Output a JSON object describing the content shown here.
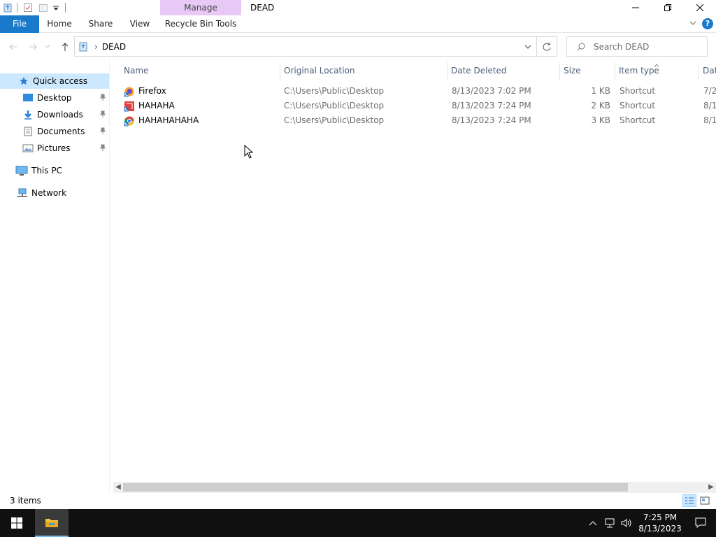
{
  "window": {
    "title": "DEAD",
    "context_tab": "Manage",
    "context_sub": "Recycle Bin Tools"
  },
  "ribbon": {
    "tabs": [
      "File",
      "Home",
      "Share",
      "View",
      "Recycle Bin Tools"
    ]
  },
  "address": {
    "crumb": "DEAD",
    "search_placeholder": "Search DEAD"
  },
  "nav": {
    "quick_access": "Quick access",
    "items": [
      "Desktop",
      "Downloads",
      "Documents",
      "Pictures"
    ],
    "this_pc": "This PC",
    "network": "Network"
  },
  "list": {
    "columns": [
      "Name",
      "Original Location",
      "Date Deleted",
      "Size",
      "Item type",
      "Dat"
    ],
    "rows": [
      {
        "name": "Firefox",
        "location": "C:\\Users\\Public\\Desktop",
        "deleted": "8/13/2023 7:02 PM",
        "size": "1 KB",
        "type": "Shortcut",
        "date": "7/2"
      },
      {
        "name": "HAHAHA",
        "location": "C:\\Users\\Public\\Desktop",
        "deleted": "8/13/2023 7:24 PM",
        "size": "2 KB",
        "type": "Shortcut",
        "date": "8/1"
      },
      {
        "name": "HAHAHAHAHA",
        "location": "C:\\Users\\Public\\Desktop",
        "deleted": "8/13/2023 7:24 PM",
        "size": "3 KB",
        "type": "Shortcut",
        "date": "8/1"
      }
    ]
  },
  "status": {
    "count": "3 items"
  },
  "taskbar": {
    "time": "7:25 PM",
    "date": "8/13/2023"
  },
  "colors": {
    "accent": "#1979ca",
    "manage_tab": "#e8c9f5",
    "selection": "#cce8ff",
    "taskbar": "#101010"
  }
}
